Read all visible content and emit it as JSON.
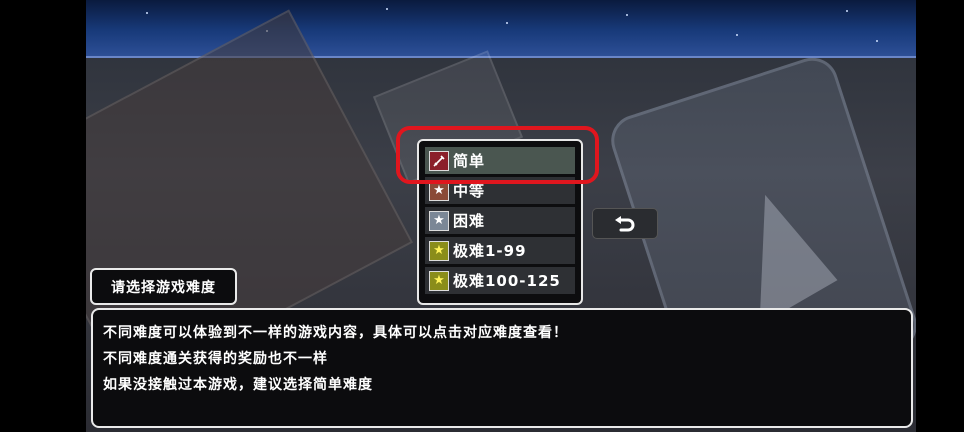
{
  "difficulty_menu": {
    "items": [
      {
        "label": "简单",
        "icon": "sword-icon",
        "selected": true
      },
      {
        "label": "中等",
        "icon": "star-icon",
        "selected": false
      },
      {
        "label": "困难",
        "icon": "star-icon",
        "selected": false
      },
      {
        "label": "极难1-99",
        "icon": "star-icon",
        "selected": false
      },
      {
        "label": "极难100-125",
        "icon": "star-icon",
        "selected": false
      }
    ]
  },
  "back_button": {
    "icon": "back-arrow-icon"
  },
  "title_label": "请选择游戏难度",
  "info": {
    "lines": [
      "不同难度可以体验到不一样的游戏内容，具体可以点击对应难度查看！",
      "不同难度通关获得的奖励也不一样",
      "如果没接触过本游戏，建议选择简单难度"
    ]
  },
  "colors": {
    "highlight_ring": "#e0161e",
    "selected_item": "#4a5650",
    "panel_border": "#e8e8e8"
  }
}
